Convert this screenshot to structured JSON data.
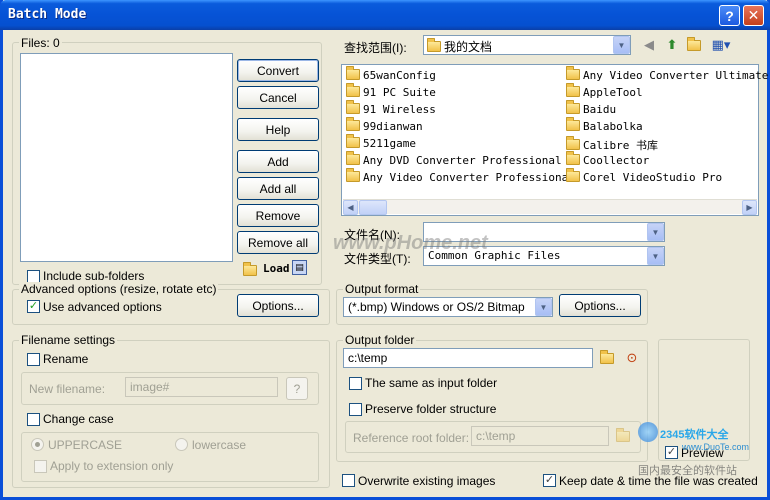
{
  "window": {
    "title": "Batch Mode"
  },
  "files": {
    "label": "Files: 0",
    "include_subfolders": "Include sub-folders",
    "include_subfolders_checked": false
  },
  "buttons": {
    "convert": "Convert",
    "cancel": "Cancel",
    "help": "Help",
    "add": "Add",
    "add_all": "Add all",
    "remove": "Remove",
    "remove_all": "Remove all",
    "load": "Load"
  },
  "browser": {
    "look_in_label": "查找范围(I):",
    "look_in_value": "我的文档",
    "folders_left": [
      "65wanConfig",
      "91 PC Suite",
      "91 Wireless",
      "99dianwan",
      "5211game",
      "Any DVD Converter Professional",
      "Any Video Converter Professional"
    ],
    "folders_right": [
      "Any Video Converter Ultimate",
      "AppleTool",
      "Baidu",
      "Balabolka",
      "Calibre 书库",
      "Coollector",
      "Corel VideoStudio Pro"
    ],
    "filename_label": "文件名(N):",
    "filename_value": "",
    "filetype_label": "文件类型(T):",
    "filetype_value": "Common Graphic Files"
  },
  "advanced": {
    "title": "Advanced options (resize, rotate etc)",
    "use_label": "Use advanced options",
    "use_checked": true,
    "options_button": "Options..."
  },
  "output_format": {
    "title": "Output format",
    "value": "(*.bmp) Windows or OS/2 Bitmap",
    "options_button": "Options..."
  },
  "filename_settings": {
    "title": "Filename settings",
    "rename_label": "Rename",
    "rename_checked": false,
    "new_filename_label": "New filename:",
    "new_filename_value": "image#",
    "help_button": "?",
    "change_case_label": "Change case",
    "change_case_checked": false,
    "uppercase_label": "UPPERCASE",
    "lowercase_label": "lowercase",
    "apply_ext_label": "Apply to extension only"
  },
  "output_folder": {
    "title": "Output folder",
    "value": "c:\\temp",
    "same_as_input": "The same as input folder",
    "preserve_structure": "Preserve folder structure",
    "reference_root_label": "Reference root folder:",
    "reference_root_value": "c:\\temp"
  },
  "preview": {
    "label": "Preview",
    "checked": true
  },
  "bottom": {
    "overwrite_label": "Overwrite existing images",
    "overwrite_checked": false,
    "keep_date_label": "Keep date & time the file was created",
    "keep_date_checked": true
  },
  "watermarks": {
    "center": "www.pHome.net",
    "brand": "2345软件大全",
    "brand_url": "www.DuoTe.com",
    "brand_sub": "国内最安全的软件站"
  }
}
